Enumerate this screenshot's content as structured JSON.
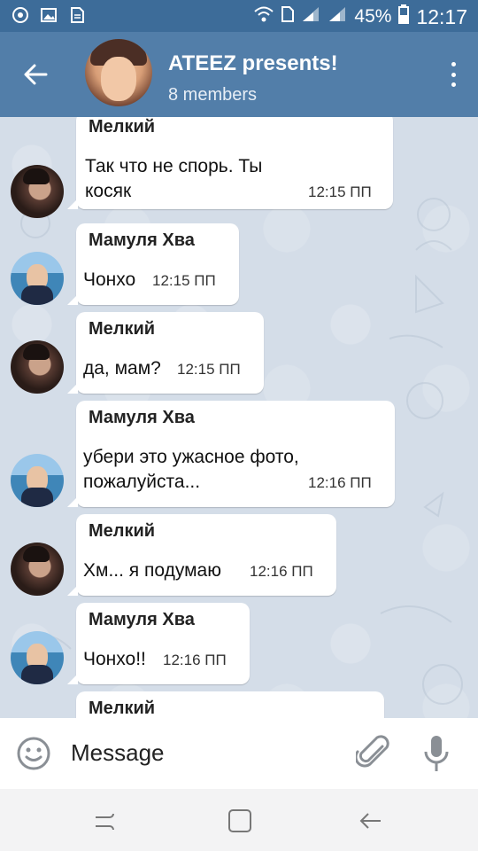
{
  "status_bar": {
    "battery": "45%",
    "time": "12:17"
  },
  "header": {
    "title": "ATEEZ presents!",
    "subtitle": "8 members"
  },
  "messages": [
    {
      "sender": "Мелкий",
      "text": "Так что не спорь. Ты\nкосяк",
      "time": "12:15 ПП",
      "avatar": "dark"
    },
    {
      "sender": "Мамуля Хва",
      "text": "Чонхо",
      "time": "12:15 ПП",
      "avatar": "sea"
    },
    {
      "sender": "Мелкий",
      "text": "да, мам?",
      "time": "12:15 ПП",
      "avatar": "dark"
    },
    {
      "sender": "Мамуля Хва",
      "text": "убери это ужасное фото,\nпожалуйста...",
      "time": "12:16 ПП",
      "avatar": "sea"
    },
    {
      "sender": "Мелкий",
      "text": "Хм... я подумаю",
      "time": "12:16 ПП",
      "avatar": "dark"
    },
    {
      "sender": "Мамуля Хва",
      "text": "Чонхо!!",
      "time": "12:16 ПП",
      "avatar": "sea"
    },
    {
      "sender": "Мелкий",
      "text": "",
      "time": "",
      "avatar": "dark"
    }
  ],
  "input": {
    "placeholder": "Message"
  },
  "icons": {
    "back": "arrow-left-icon",
    "menu": "more-vertical-icon",
    "emoji": "smile-icon",
    "attach": "paperclip-icon",
    "mic": "microphone-icon",
    "nav_recent": "recent-apps-icon",
    "nav_home": "home-icon",
    "nav_back": "back-icon"
  },
  "colors": {
    "header": "#527ea9",
    "status_bar": "#3d6c99",
    "chat_background": "#d4dde8",
    "bubble": "#ffffff"
  }
}
